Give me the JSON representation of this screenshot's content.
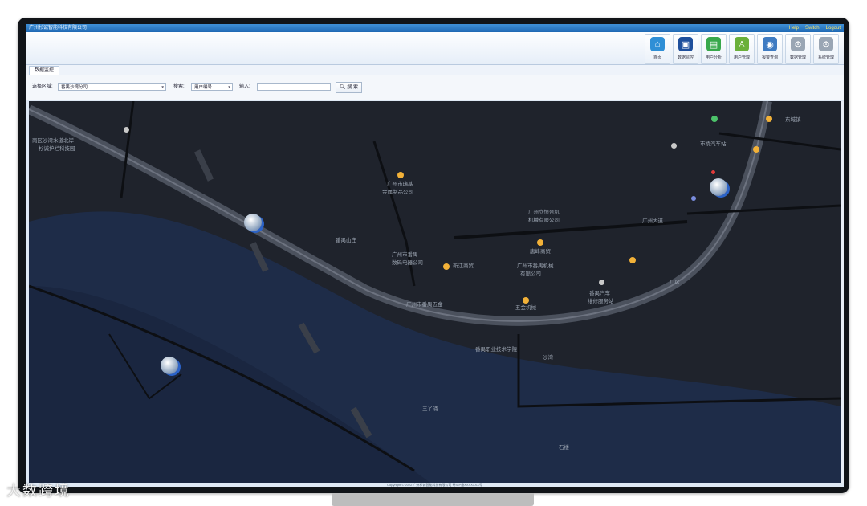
{
  "window": {
    "title": "广州杉诚智能科技有限公司",
    "title_right": [
      "Help",
      "Switch",
      "Logout"
    ]
  },
  "toolbar": {
    "buttons": [
      {
        "label": "首页",
        "icon": "home-icon",
        "color": "#2f8fd6"
      },
      {
        "label": "数据监控",
        "icon": "monitor-icon",
        "color": "#1e4f9c"
      },
      {
        "label": "用户分析",
        "icon": "chart-icon",
        "color": "#38a84b"
      },
      {
        "label": "用户管理",
        "icon": "user-icon",
        "color": "#6bb03a"
      },
      {
        "label": "报警查询",
        "icon": "alarm-icon",
        "color": "#3e7bc2"
      },
      {
        "label": "数据管理",
        "icon": "gear-icon",
        "color": "#9aa6b4"
      },
      {
        "label": "系统管理",
        "icon": "settings-icon",
        "color": "#9aa6b4"
      }
    ]
  },
  "tabs": [
    {
      "label": "数据监控"
    }
  ],
  "filters": {
    "region_label": "选择区域:",
    "region_value": "番禺沙湾分司",
    "search_label": "搜索:",
    "search_by_value": "用户编号",
    "input_label": "输入:",
    "search_input_value": "",
    "search_button": "搜 索"
  },
  "map": {
    "labels": [
      "南区沙湾水道北岸",
      "杉诚护栏科技园",
      "广州市瑞基",
      "金属制品公司",
      "番禺山庄",
      "广州市番禺",
      "数码电器公司",
      "新江商贸",
      "广州立恒合机",
      "机械有限公司",
      "唐峰商贸",
      "广州市番禺机械",
      "有限公司",
      "五金机械",
      "番禺汽车",
      "维修服务站",
      "广州大道",
      "厂区",
      "市桥汽车站",
      "广州市番禺五金",
      "番禺职业技术学院",
      "沙湾",
      "三丫涌",
      "石楼",
      "东城镇"
    ]
  },
  "footer": {
    "text": "Copyright © 2022 广州杉诚智能科技有限公司 粤ICP备XXXXXXX号"
  },
  "watermark": {
    "text": "大数跨境"
  }
}
